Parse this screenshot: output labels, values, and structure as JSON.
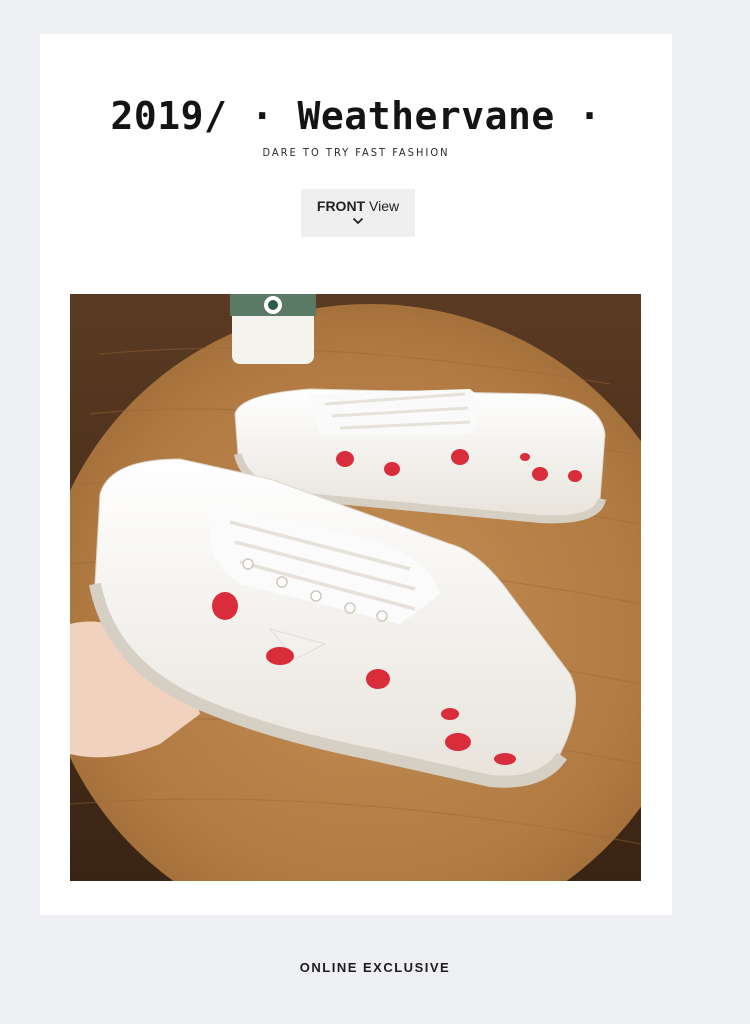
{
  "header": {
    "title": "2019/ · Weathervane ·",
    "tagline": "DARE TO TRY FAST FASHION"
  },
  "view_toggle": {
    "bold": "FRONT",
    "rest": "View",
    "icon": "chevron-down-icon"
  },
  "photo": {
    "description_icon": "product-photo"
  },
  "footer": {
    "label": "ONLINE EXCLUSIVE"
  },
  "colors": {
    "background": "#eff0f4",
    "card": "#ffffff",
    "button": "#efefef",
    "table_wood": "#b9844a",
    "strawberry": "#d92d3c"
  }
}
